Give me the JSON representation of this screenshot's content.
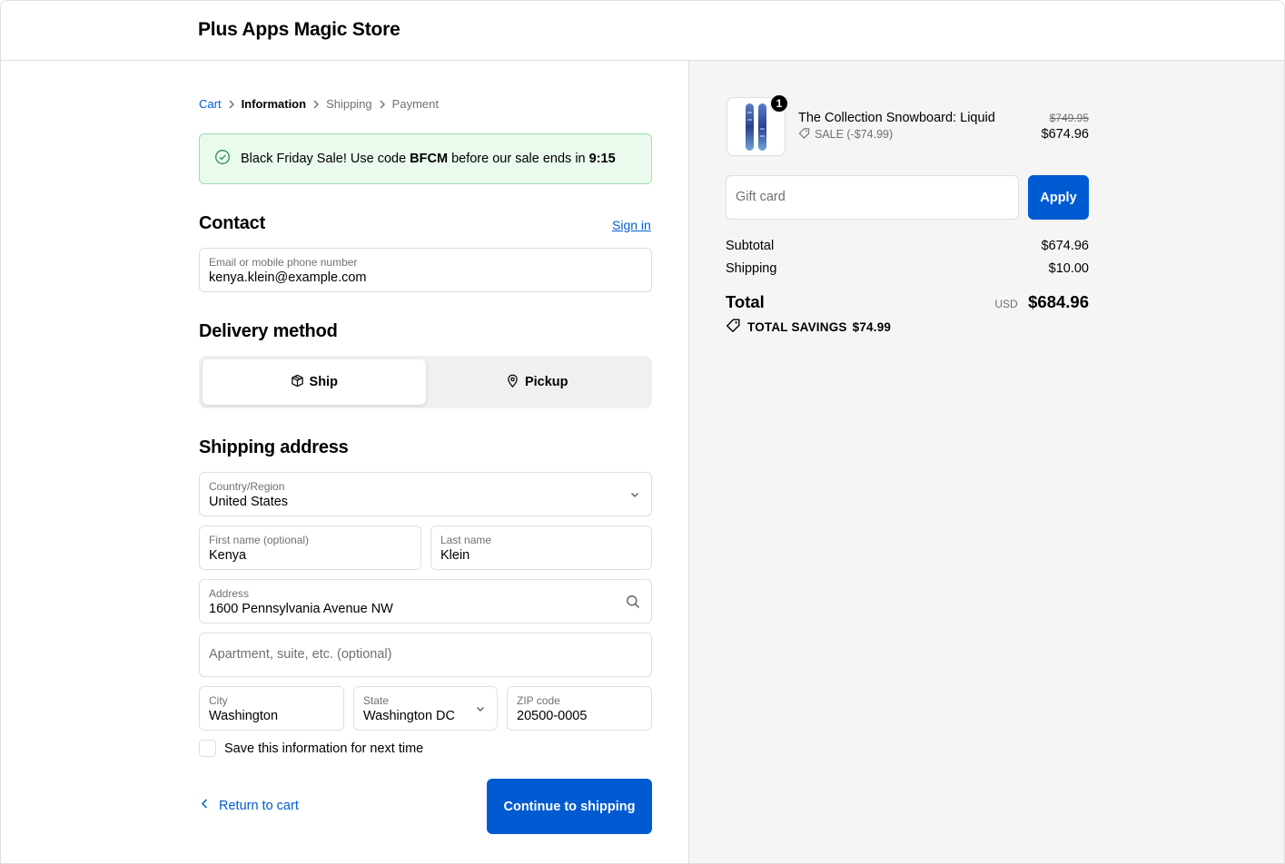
{
  "header": {
    "store_name": "Plus Apps Magic Store"
  },
  "breadcrumb": {
    "items": [
      {
        "label": "Cart",
        "state": "link"
      },
      {
        "label": "Information",
        "state": "current"
      },
      {
        "label": "Shipping",
        "state": "upcoming"
      },
      {
        "label": "Payment",
        "state": "upcoming"
      }
    ]
  },
  "banner": {
    "text_before": "Black Friday Sale! Use code ",
    "code": "BFCM",
    "text_middle": " before our sale ends in ",
    "timer": "9:15",
    "icon": "check-circle-icon"
  },
  "contact": {
    "heading": "Contact",
    "sign_in": "Sign in",
    "email_label": "Email or mobile phone number",
    "email_value": "kenya.klein@example.com"
  },
  "delivery": {
    "heading": "Delivery method",
    "options": [
      {
        "label": "Ship",
        "icon": "box-icon",
        "selected": true
      },
      {
        "label": "Pickup",
        "icon": "location-pin-icon",
        "selected": false
      }
    ]
  },
  "shipping_address": {
    "heading": "Shipping address",
    "country_label": "Country/Region",
    "country_value": "United States",
    "first_name_label": "First name (optional)",
    "first_name_value": "Kenya",
    "last_name_label": "Last name",
    "last_name_value": "Klein",
    "address_label": "Address",
    "address_value": "1600 Pennsylvania Avenue NW",
    "apartment_placeholder": "Apartment, suite, etc. (optional)",
    "city_label": "City",
    "city_value": "Washington",
    "state_label": "State",
    "state_value": "Washington DC",
    "zip_label": "ZIP code",
    "zip_value": "20500-0005",
    "save_info_label": "Save this information for next time",
    "save_info_checked": false
  },
  "actions": {
    "return_label": "Return to cart",
    "continue_label": "Continue to shipping"
  },
  "summary": {
    "product": {
      "name": "The Collection Snowboard: Liquid",
      "quantity": "1",
      "sale_label": "SALE (-$74.99)",
      "original_price": "$749.95",
      "price": "$674.96"
    },
    "gift_card_placeholder": "Gift card",
    "apply_label": "Apply",
    "subtotal_label": "Subtotal",
    "subtotal_value": "$674.96",
    "shipping_label": "Shipping",
    "shipping_value": "$10.00",
    "total_label": "Total",
    "currency": "USD",
    "total_value": "$684.96",
    "savings_label": "TOTAL SAVINGS",
    "savings_value": "$74.99"
  },
  "colors": {
    "accent": "#005bd3",
    "banner_bg": "#eafbee",
    "banner_border": "#9fdcaf",
    "sidebar_bg": "#f5f5f5"
  }
}
